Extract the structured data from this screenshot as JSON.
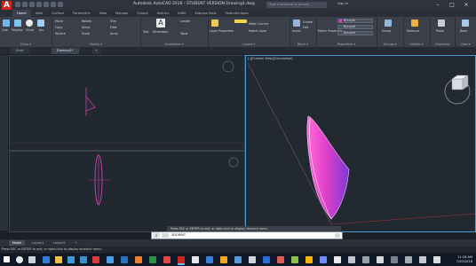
{
  "window": {
    "title": "Autodesk AutoCAD 2016 - STUDENT VERSION   Drawing1.dwg",
    "search_placeholder": "Type a keyword or phrase",
    "signin": "Sign In",
    "minimize": "–",
    "maximize": "□",
    "close": "×"
  },
  "ribbon_tabs": [
    "Home",
    "Solid",
    "Surface",
    "Parametric",
    "View",
    "Manage",
    "Output",
    "Add-ins",
    "A360",
    "Express Tools",
    "Featured Apps"
  ],
  "ribbon_groups": [
    {
      "label": "Draw ▾",
      "items": [
        "Line",
        "Polyline",
        "Circle",
        "Arc"
      ]
    },
    {
      "label": "Modify ▾",
      "items": [
        "Move",
        "Rotate",
        "Trim",
        "Copy",
        "Mirror",
        "Fillet",
        "Stretch",
        "Scale",
        "Array"
      ]
    },
    {
      "label": "Annotation ▾",
      "items": [
        "Text",
        "Dimension",
        "Leader",
        "Table"
      ]
    },
    {
      "label": "Layers ▾",
      "items": [
        "Layer Properties",
        "Make Current",
        "Match Layer"
      ]
    },
    {
      "label": "Block ▾",
      "items": [
        "Insert",
        "Create",
        "Edit"
      ]
    },
    {
      "label": "Properties ▾",
      "items": [
        "Match Properties",
        "ByLayer",
        "ByLayer",
        "ByLayer"
      ]
    },
    {
      "label": "Groups ▾",
      "items": [
        "Group"
      ]
    },
    {
      "label": "Utilities ▾",
      "items": [
        "Measure"
      ]
    },
    {
      "label": "Clipboard",
      "items": [
        "Paste"
      ]
    },
    {
      "label": "View ▾",
      "items": [
        "Base"
      ]
    }
  ],
  "file_tabs": [
    "Start",
    "Drawing1*"
  ],
  "viewport_right_label": "[-][Custom View][Conceptual]",
  "command": {
    "history": "Press ESC or ENTER to exit, or right-click to display shortcut menu.",
    "current": "3DORBIT",
    "close_glyph": "×"
  },
  "layout_tabs": [
    "Model",
    "Layout1",
    "Layout2"
  ],
  "status_text": "Press ESC or ENTER to exit, or right-click to display shortcut menu.",
  "clock": {
    "time": "11:16 AM",
    "date": "7/20/2016"
  },
  "colors": {
    "accent": "#4aa0d8",
    "brand": "#c9261e",
    "shape_magenta": "#e040c8",
    "shape_purple": "#8a3ad8"
  },
  "icons": [
    "autocad-logo-icon",
    "viewcube-icon",
    "navigation-wheel-icon",
    "start-menu-icon"
  ]
}
